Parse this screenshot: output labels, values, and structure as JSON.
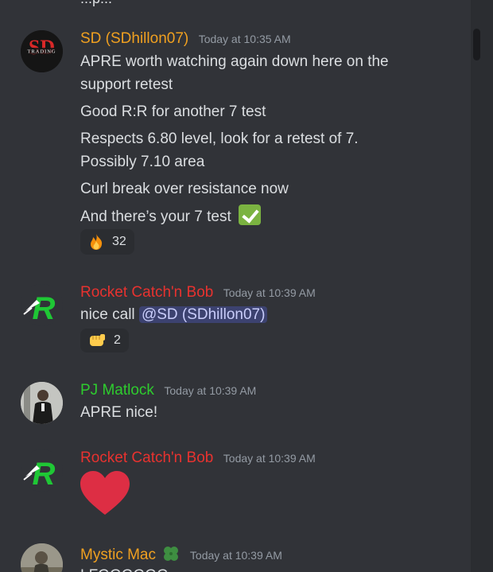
{
  "top_fragment": "...p...",
  "messages": [
    {
      "author": "SD (SDhillon07)",
      "author_color": "#f0a020",
      "timestamp": "Today at 10:35 AM",
      "avatar_text": "SD",
      "avatar_sub": "TRADING",
      "lines": [
        "APRE worth watching again down here on the",
        "support retest",
        "Good R:R for another 7 test",
        "Respects 6.80 level, look for a retest of 7.",
        "Possibly 7.10 area",
        "Curl break over resistance now",
        "And there’s your 7 test"
      ],
      "reaction": {
        "icon": "fire-emoji",
        "count": "32"
      }
    },
    {
      "author": "Rocket Catch'n Bob",
      "author_color": "#e8322f",
      "timestamp": "Today at 10:39 AM",
      "avatar_text": "R",
      "text": "nice call",
      "mention": "@SD (SDhillon07)",
      "reaction": {
        "icon": "fist-bump-emoji",
        "count": "2"
      }
    },
    {
      "author": "PJ Matlock",
      "author_color": "#2ecc2e",
      "timestamp": "Today at 10:39 AM",
      "text": "APRE nice!"
    },
    {
      "author": "Rocket Catch'n Bob",
      "author_color": "#e8322f",
      "timestamp": "Today at 10:39 AM",
      "avatar_text": "R",
      "content_icon": "red-heart-emoji"
    },
    {
      "author": "Mystic Mac",
      "author_color": "#f0a020",
      "timestamp": "Today at 10:39 AM",
      "author_icon": "four-leaf-clover-emoji",
      "text": "LFGGGGGG"
    }
  ],
  "colors": {
    "background": "#313338",
    "text": "#dbdee1",
    "timestamp": "#949ba4",
    "mention_bg": "#3c4270",
    "rocket_green": "#1fc735"
  }
}
